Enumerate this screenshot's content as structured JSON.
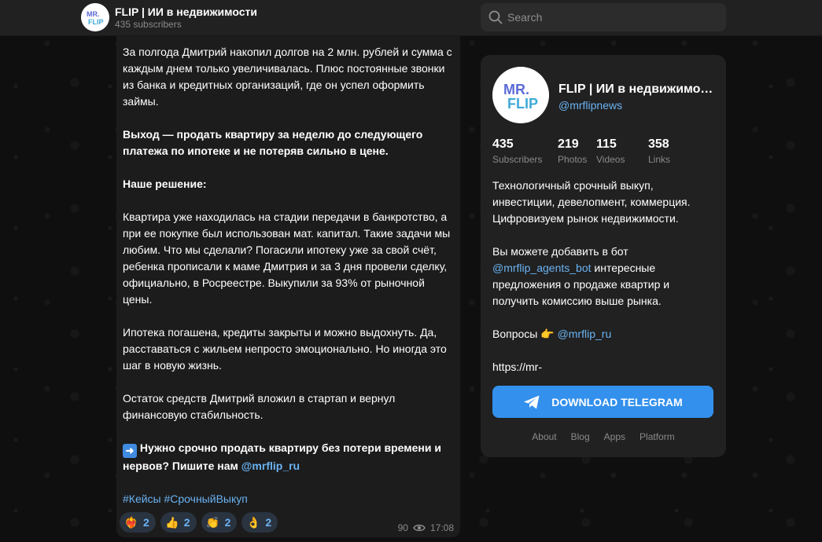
{
  "header": {
    "title": "FLIP | ИИ в недвижимости",
    "subscribers": "435 subscribers",
    "logo_text_top": "MR.",
    "logo_text_bottom": "FLIP"
  },
  "search": {
    "placeholder": "Search"
  },
  "message": {
    "p1": "За полгода Дмитрий накопил долгов на 2 млн. рублей и сумма с каждым днем только увеличивалась. Плюс постоянные звонки из банка и кредитных организаций, где он успел оформить займы.",
    "p2": "Выход — продать квартиру за неделю до следующего платежа по ипотеке и не потеряв сильно в цене.",
    "p3": "Наше решение:",
    "p4": "Квартира уже находилась на стадии передачи в банкротство, а при ее покупке был использован мат. капитал. Такие задачи мы любим. Что мы сделали? Погасили ипотеку уже за свой счёт, ребенка прописали к маме Дмитрия и за 3 дня провели сделку, официально, в Росреестре. Выкупили за 93% от рыночной цены.",
    "p5": "Ипотека погашена, кредиты закрыты и можно выдохнуть. Да, расставаться с жильем непросто эмоционально. Но иногда это шаг в новую жизнь.",
    "p6": "Остаток средств Дмитрий вложил в стартап и вернул финансовую стабильность.",
    "p7_emoji": "➡️",
    "p7_text": " Нужно срочно продать квартиру без потери времени и нервов? Пишите нам ",
    "p7_link": "@mrflip_ru",
    "tags": "#Кейсы #СрочныйВыкуп",
    "views": "90",
    "time": "17:08",
    "reactions": [
      {
        "emoji": "❤️‍🔥",
        "count": "2"
      },
      {
        "emoji": "👍",
        "count": "2"
      },
      {
        "emoji": "👏",
        "count": "2"
      },
      {
        "emoji": "👌",
        "count": "2"
      }
    ]
  },
  "panel": {
    "title": "FLIP | ИИ в недвижимос…",
    "username": "@mrflipnews",
    "stats": [
      {
        "value": "435",
        "label": "Subscribers"
      },
      {
        "value": "219",
        "label": "Photos"
      },
      {
        "value": "115",
        "label": "Videos"
      },
      {
        "value": "358",
        "label": "Links"
      }
    ],
    "about1": "Технологичный срочный выкуп, инвестиции, девелопмент, коммерция. Цифровизуем рынок недвижимости.",
    "about2_pre": "Вы можете добавить в бот ",
    "about2_link": "@mrflip_agents_bot",
    "about2_post": " интересные предложения о продаже квартир и получить комиссию выше рынка.",
    "about3_pre": "Вопросы 👉 ",
    "about3_link": "@mrflip_ru",
    "about4": "https://mr-",
    "download_label": "DOWNLOAD TELEGRAM",
    "footer": [
      "About",
      "Blog",
      "Apps",
      "Platform"
    ]
  },
  "colors": {
    "accent": "#3390ec",
    "link": "#6ab3f3",
    "panel": "#212121",
    "bubble": "#1c1c1c"
  }
}
